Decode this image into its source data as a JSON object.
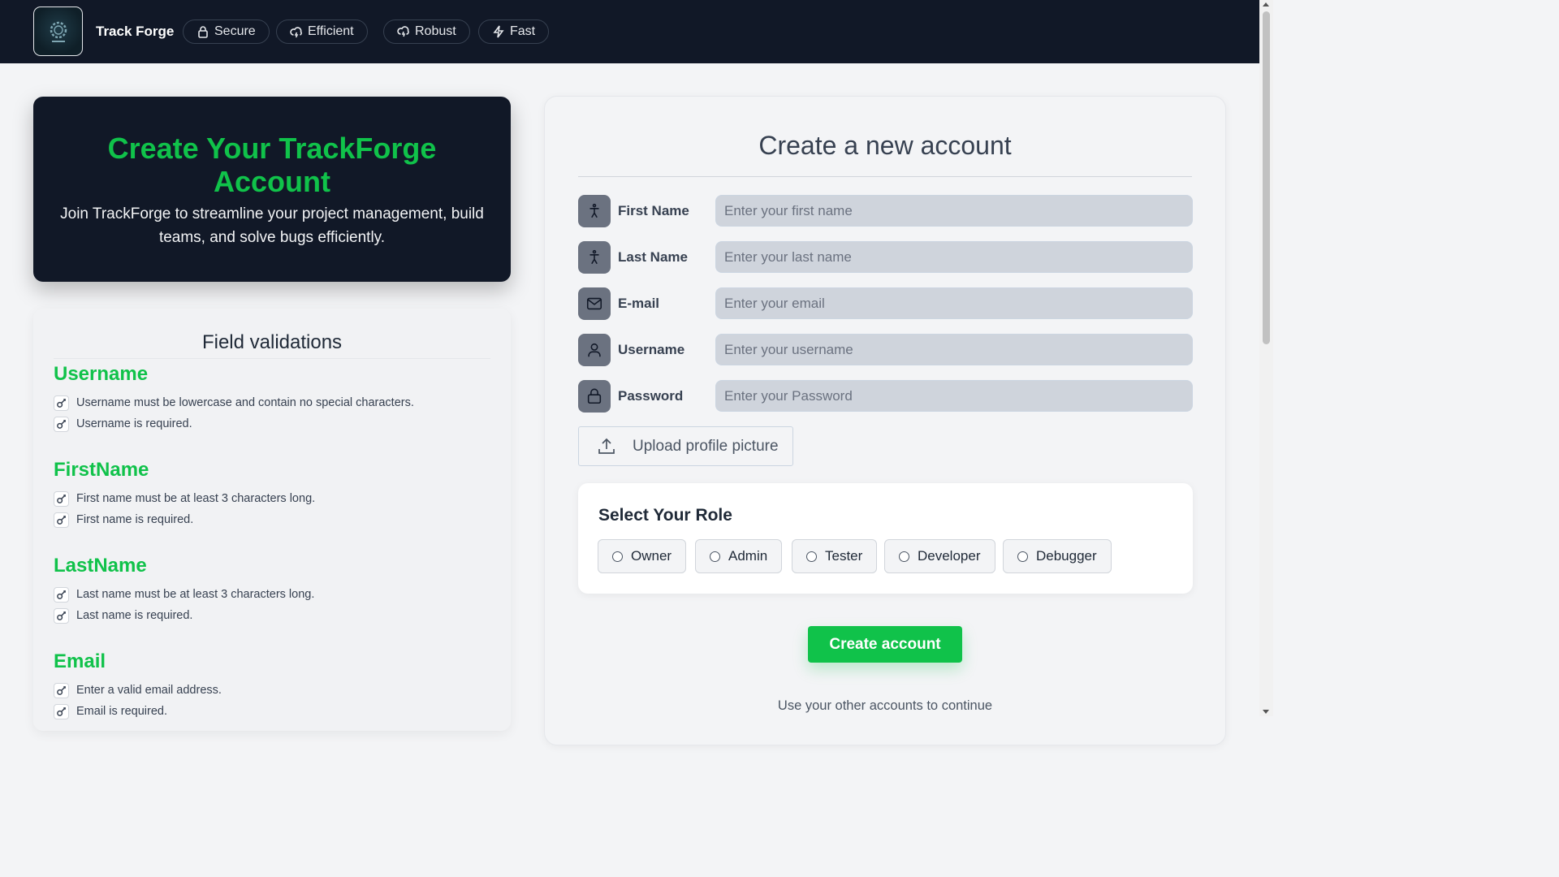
{
  "nav": {
    "brand": "Track Forge",
    "items": [
      {
        "label": "Secure",
        "icon": "lock-icon"
      },
      {
        "label": "Efficient",
        "icon": "cloud-lightning-icon"
      },
      {
        "label": "Robust",
        "icon": "cloud-bolt-icon"
      },
      {
        "label": "Fast",
        "icon": "lightning-icon"
      }
    ]
  },
  "hero": {
    "title": "Create Your TrackForge Account",
    "subtitle": "Join TrackForge to streamline your project management, build teams, and solve bugs efficiently."
  },
  "validations": {
    "title": "Field validations",
    "sections": [
      {
        "name": "Username",
        "rules": [
          "Username must be lowercase and contain no special characters.",
          "Username is required."
        ]
      },
      {
        "name": "FirstName",
        "rules": [
          "First name must be at least 3 characters long.",
          "First name is required."
        ]
      },
      {
        "name": "LastName",
        "rules": [
          "Last name must be at least 3 characters long.",
          "Last name is required."
        ]
      },
      {
        "name": "Email",
        "rules": [
          "Enter a valid email address.",
          "Email is required."
        ]
      }
    ]
  },
  "form": {
    "title": "Create a new account",
    "fields": [
      {
        "label": "First Name",
        "placeholder": "Enter your first name",
        "value": "",
        "icon": "person-icon"
      },
      {
        "label": "Last Name",
        "placeholder": "Enter your last name",
        "value": "",
        "icon": "person-icon"
      },
      {
        "label": "E-mail",
        "placeholder": "Enter your email",
        "value": "",
        "icon": "mail-icon"
      },
      {
        "label": "Username",
        "placeholder": "Enter your username",
        "value": "",
        "icon": "user-icon"
      },
      {
        "label": "Password",
        "placeholder": "Enter your Password",
        "value": "",
        "icon": "lock-icon"
      }
    ],
    "upload_label": "Upload profile picture",
    "role": {
      "title": "Select Your Role",
      "options": [
        "Owner",
        "Admin",
        "Tester",
        "Developer",
        "Debugger"
      ]
    },
    "submit_label": "Create account",
    "other_accounts": "Use your other accounts to continue"
  },
  "colors": {
    "accent": "#10c24a",
    "nav_bg": "#111827",
    "page_bg": "#f3f4f6"
  }
}
